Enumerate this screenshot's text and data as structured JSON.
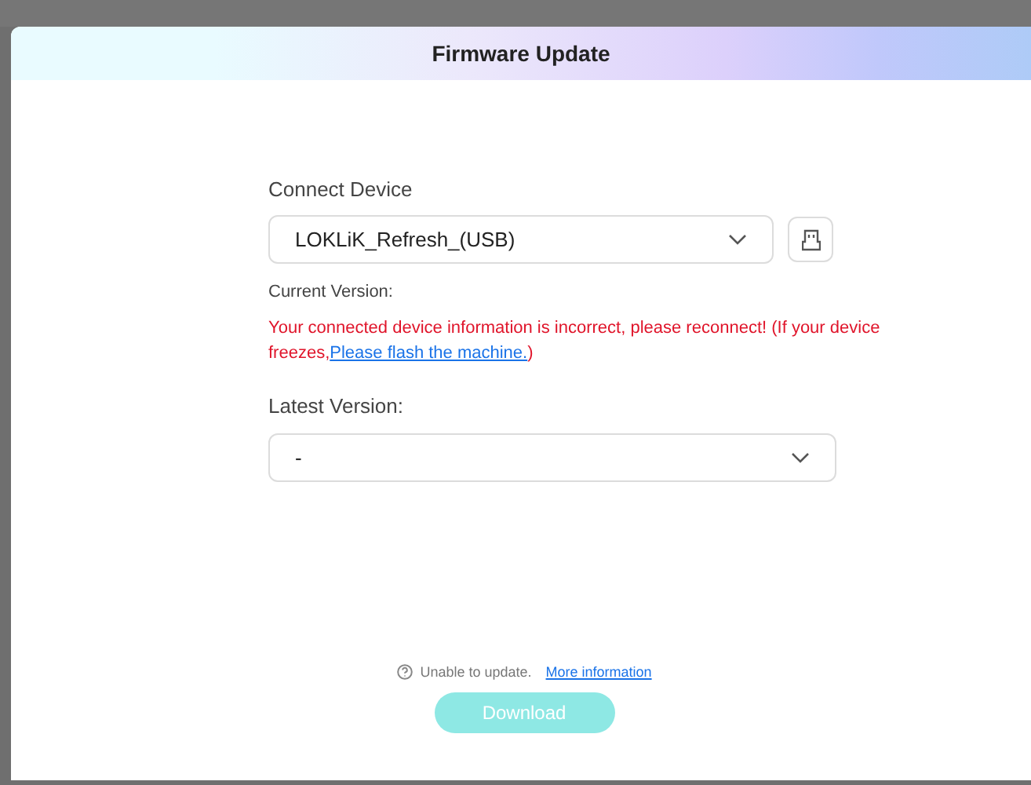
{
  "dialog": {
    "title": "Firmware Update"
  },
  "connect_device": {
    "label": "Connect Device",
    "value": "LOKLiK_Refresh_(USB)"
  },
  "current_version": {
    "label": "Current Version:",
    "error": "Your connected device information is incorrect, please reconnect! (If your device freezes,",
    "link": "Please flash the machine.",
    "error_end": ")"
  },
  "latest_version": {
    "label": "Latest Version:",
    "value": "-"
  },
  "footer": {
    "note": "Unable to update.",
    "link": "More information"
  },
  "download_button": {
    "label": "Download",
    "disabled": true
  }
}
